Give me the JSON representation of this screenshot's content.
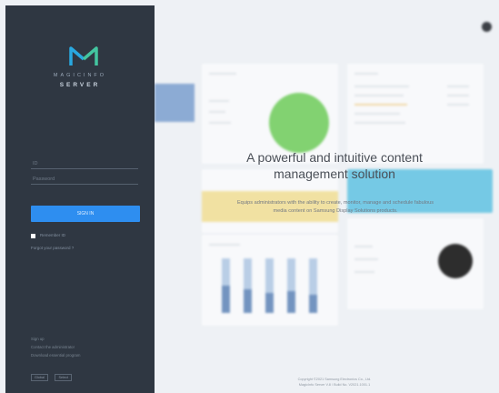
{
  "brand": {
    "line1": "MAGICINFO",
    "line2": "SERVER",
    "accent_color": "#2e8ef0",
    "logo_colors": [
      "#29a8e0",
      "#43c5a0"
    ]
  },
  "login": {
    "id_placeholder": "ID",
    "password_placeholder": "Password",
    "signin_label": "SIGN IN",
    "remember_label": "Remember ID",
    "forgot_label": "Forgot your password ?"
  },
  "footer_links": {
    "signup": "Sign up",
    "contact": "Contact the administrator",
    "download": "Download essential program",
    "languages": [
      "Global",
      "Select"
    ]
  },
  "hero": {
    "headline": "A powerful and intuitive content management solution",
    "subtext": "Equips administrators with the ability to create, monitor, manage and schedule fabulous media content on Samsung Display Solutions products."
  },
  "copyright": {
    "line1": "Copyright ©2021 Samsung Electronics Co., Ltd.",
    "line2": "MagicInfo Server V.8 / Build No. V2021.1001.1"
  }
}
